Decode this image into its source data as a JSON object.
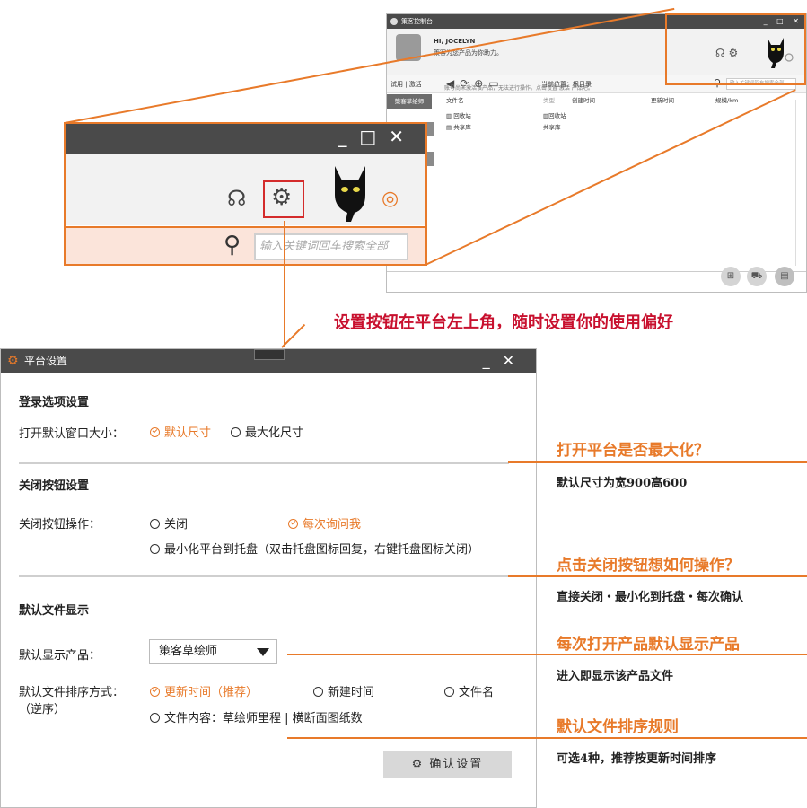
{
  "console": {
    "title": "策客控制台",
    "greeting": "HI, JOCELYN",
    "message": "策客为您产品为你助力。",
    "trial_label": "试用 | 激活",
    "location_label": "当前位置：根目录",
    "search_placeholder": "输入关键词回车搜索全部",
    "sidebar_active": "策客草绘师",
    "notice": "账号尚未激活该产品，无法进行操作。点击设置 激活 产品吧。",
    "columns": [
      "文件名",
      "类型",
      "创建时间",
      "更新时间",
      "规模/km"
    ],
    "rows": [
      {
        "name": "回收站",
        "type": "回收站"
      },
      {
        "name": "共享库",
        "type": "共享库"
      }
    ]
  },
  "zoom": {
    "search_placeholder": "输入关键词回车搜索全部"
  },
  "slogan": "设置按钮在平台左上角，随时设置你的使用偏好",
  "dialog": {
    "title": "平台设置",
    "sections": {
      "login": "登录选项设置",
      "close": "关闭按钮设置",
      "files": "默认文件显示"
    },
    "window_size": {
      "label": "打开默认窗口大小：",
      "options": [
        "默认尺寸",
        "最大化尺寸"
      ],
      "selected": "默认尺寸"
    },
    "close_action": {
      "label": "关闭按钮操作：",
      "options": [
        "关闭",
        "每次询问我",
        "最小化平台到托盘（双击托盘图标回复，右键托盘图标关闭）"
      ],
      "selected": "每次询问我"
    },
    "default_product": {
      "label": "默认显示产品：",
      "value": "策客草绘师"
    },
    "sort": {
      "label": "默认文件排序方式：",
      "label2": "（逆序）",
      "options": [
        "更新时间（推荐）",
        "新建时间",
        "文件名",
        "文件内容：草绘师里程 | 横断面图纸数"
      ],
      "selected": "更新时间（推荐）"
    },
    "confirm_label": "确认设置"
  },
  "annotations": [
    {
      "heading": "打开平台是否最大化？",
      "text": "默认尺寸为宽900高600"
    },
    {
      "heading": "点击关闭按钮想如何操作？",
      "text": "直接关闭・最小化到托盘・每次确认"
    },
    {
      "heading": "每次打开产品默认显示产品",
      "text": "进入即显示该产品文件"
    },
    {
      "heading": "默认文件排序规则",
      "text": "可选4种，推荐按更新时间排序"
    }
  ],
  "colors": {
    "accent": "#e87a2a",
    "title_bar": "#4a4a4a",
    "slogan": "#c8102e"
  }
}
